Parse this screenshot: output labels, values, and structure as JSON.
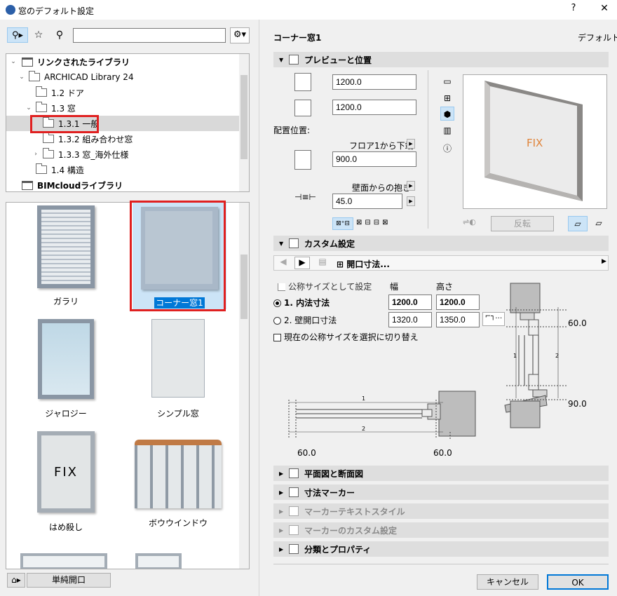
{
  "window": {
    "title": "窓のデフォルト設定",
    "help": "?",
    "close": "✕"
  },
  "left": {
    "search_placeholder": "",
    "tree": [
      {
        "label": "リンクされたライブラリ",
        "bold": true
      },
      {
        "label": "ARCHICAD Library 24"
      },
      {
        "label": "1.2 ドア"
      },
      {
        "label": "1.3 窓"
      },
      {
        "label": "1.3.1 一般"
      },
      {
        "label": "1.3.2 組み合わせ窓"
      },
      {
        "label": "1.3.3 窓_海外仕様"
      },
      {
        "label": "1.4 構造"
      },
      {
        "label": "BIMcloudライブラリ",
        "bold": true
      }
    ],
    "gallery": [
      {
        "label": "ガラリ"
      },
      {
        "label": "コーナー窓1"
      },
      {
        "label": "ジャロジー"
      },
      {
        "label": "シンプル窓"
      },
      {
        "label": "はめ殺し",
        "thumb_text": "FIX"
      },
      {
        "label": "ボウウインドウ"
      }
    ],
    "footer_button": "単純開口"
  },
  "right": {
    "title": "コーナー窓1",
    "default_label": "デフォルト",
    "preview_section": "プレビューと位置",
    "width": "1200.0",
    "height": "1200.0",
    "placement_label": "配置位置:",
    "floor_ref": "フロア1から下端",
    "floor_value": "900.0",
    "wall_ref": "壁面からの抱き",
    "wall_value": "45.0",
    "preview_text": "FIX",
    "flip_label": "反転",
    "custom_section": "カスタム設定",
    "nav_label": "開口寸法...",
    "nominal_check": "公称サイズとして設定",
    "col_width": "幅",
    "col_height": "高さ",
    "opt1_label": "1. 内法寸法",
    "opt1_w": "1200.0",
    "opt1_h": "1200.0",
    "opt2_label": "2. 壁開口寸法",
    "opt2_w": "1320.0",
    "opt2_h": "1350.0",
    "switch_check": "現在の公称サイズを選択に切り替え",
    "dim_60_right": "60.0",
    "dim_90": "90.0",
    "dim_60_a": "60.0",
    "dim_60_b": "60.0",
    "dim_1": "1",
    "dim_2": "2",
    "sections": [
      "平面図と断面図",
      "寸法マーカー",
      "マーカーテキストスタイル",
      "マーカーのカスタム設定",
      "分類とプロパティ"
    ],
    "cancel": "キャンセル",
    "ok": "OK"
  }
}
